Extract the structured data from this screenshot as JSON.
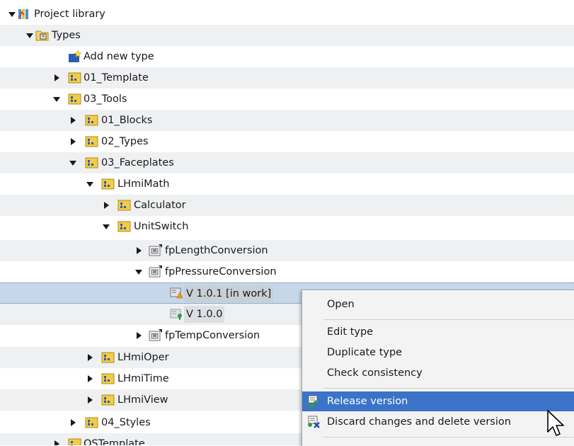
{
  "tree": {
    "project_library": "Project library",
    "types": "Types",
    "add_new_type": "Add new type",
    "template_01": "01_Template",
    "tools_03": "03_Tools",
    "blocks_01": "01_Blocks",
    "types_02": "02_Types",
    "faceplates_03": "03_Faceplates",
    "lhmimath": "LHmiMath",
    "calculator": "Calculator",
    "unitswitch": "UnitSwitch",
    "fp_length": "fpLengthConversion",
    "fp_pressure": "fpPressureConversion",
    "version_in_work": "V 1.0.1 [in work]",
    "version_released": "V 1.0.0",
    "fp_temp": "fpTempConversion",
    "lhmioper": "LHmiOper",
    "lhmitime": "LHmiTime",
    "lhmiview": "LHmiView",
    "styles_04": "04_Styles",
    "ostemplate": "OSTemplate"
  },
  "context_menu": {
    "open": "Open",
    "edit_type": "Edit type",
    "duplicate_type": "Duplicate type",
    "check_consistency": "Check consistency",
    "release_version": "Release version",
    "discard_changes": "Discard changes and delete version"
  },
  "colors": {
    "folder": "#e8b923",
    "menu_highlight": "#3b73c8",
    "selection": "#c6d7ea"
  }
}
